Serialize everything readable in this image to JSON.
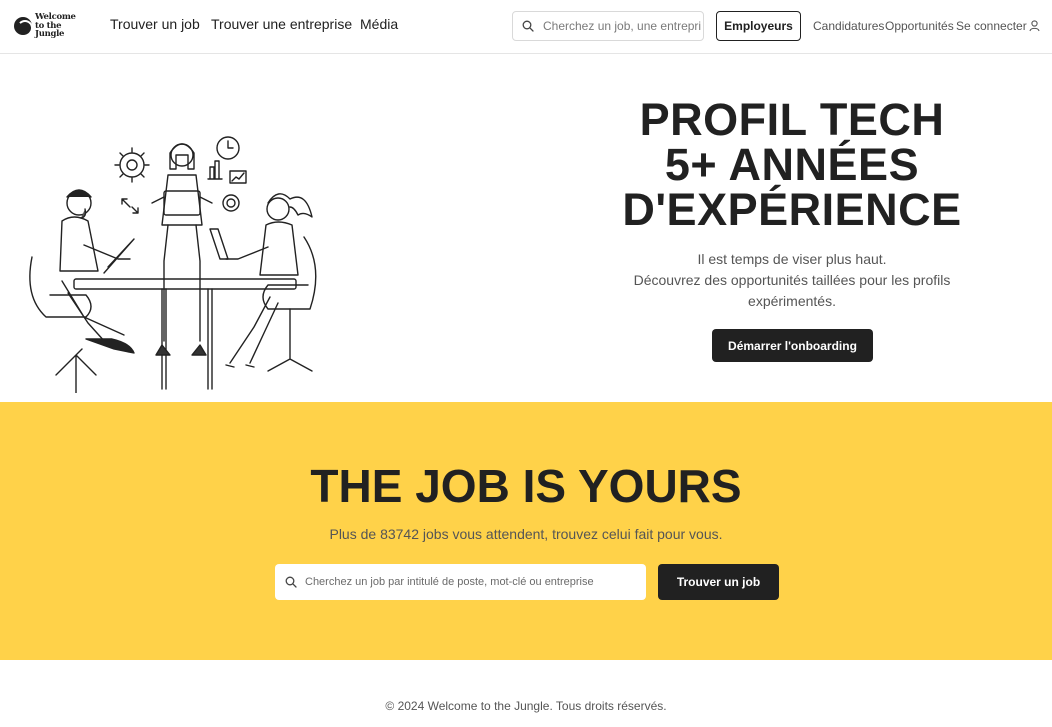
{
  "header": {
    "logo_line1": "Welcome",
    "logo_line2": "to the Jungle",
    "nav": [
      "Trouver un job",
      "Trouver une entreprise",
      "Média"
    ],
    "search_placeholder": "Cherchez un job, une entreprise...",
    "employers_label": "Employeurs",
    "links": [
      "Candidatures",
      "Opportunités",
      "Se connecter"
    ]
  },
  "hero": {
    "title_lines": [
      "PROFIL TECH",
      "5+ ANNÉES",
      "D'EXPÉRIENCE"
    ],
    "subtitle_lines": [
      "Il est temps de viser plus haut.",
      "Découvrez des opportunités taillées pour les profils",
      "expérimentés."
    ],
    "cta_label": "Démarrer l'onboarding"
  },
  "jobs": {
    "title": "THE JOB IS YOURS",
    "subtitle": "Plus de 83742 jobs vous attendent, trouvez celui fait pour vous.",
    "search_placeholder": "Cherchez un job par intitulé de poste, mot-clé ou entreprise",
    "search_button": "Trouver un job"
  },
  "footer": {
    "copyright": "© 2024 Welcome to the Jungle. Tous droits réservés."
  },
  "icons": {
    "search": "search-icon",
    "user": "user-icon"
  },
  "colors": {
    "accent_yellow": "#ffd249",
    "dark": "#212121",
    "muted_text": "#555555"
  }
}
